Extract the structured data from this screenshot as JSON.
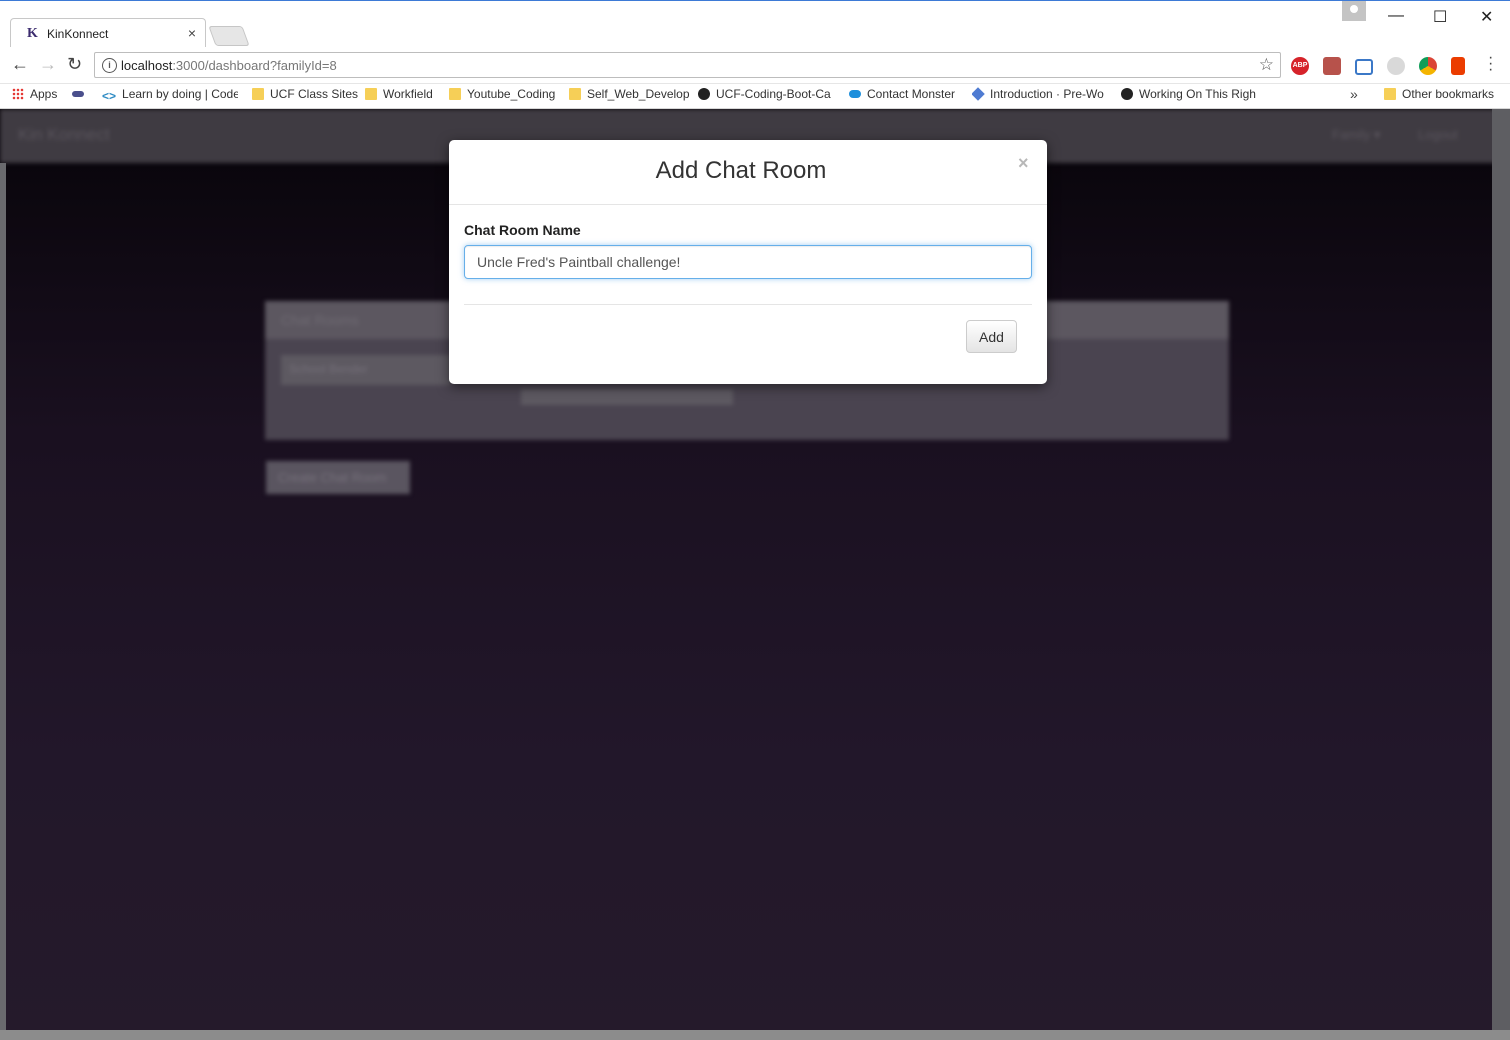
{
  "browser": {
    "tab_title": "KinKonnect",
    "tab_favicon": "K",
    "tab_close": "×",
    "url_host": "localhost",
    "url_rest": ":3000/dashboard?familyId=8",
    "window_controls": {
      "minimize": "—",
      "maximize": "☐",
      "close": "✕"
    }
  },
  "bookmarks": [
    {
      "label": "Apps",
      "icon": "apps-grid-icon"
    },
    {
      "label": "",
      "icon": "extension-oval-icon"
    },
    {
      "label": "Learn by doing | Code",
      "icon": "code-brackets-icon"
    },
    {
      "label": "UCF Class Sites",
      "icon": "folder-icon"
    },
    {
      "label": "Workfield",
      "icon": "folder-icon"
    },
    {
      "label": "Youtube_Coding",
      "icon": "folder-icon"
    },
    {
      "label": "Self_Web_Develop",
      "icon": "folder-icon"
    },
    {
      "label": "UCF-Coding-Boot-Ca",
      "icon": "github-icon"
    },
    {
      "label": "Contact Monster",
      "icon": "cloud-icon"
    },
    {
      "label": "Introduction · Pre-Wo",
      "icon": "book-icon"
    },
    {
      "label": "Working On This Righ",
      "icon": "github-icon"
    },
    {
      "label": "»",
      "icon": "chevron-double-icon"
    },
    {
      "label": "Other bookmarks",
      "icon": "folder-icon"
    }
  ],
  "background_page": {
    "brand": "Kin Konnect",
    "nav_family": "Family ▾",
    "nav_logout": "Logout",
    "panel_title": "Chat Rooms",
    "panel_input_placeholder": "School Bender",
    "create_button": "Create Chat Room"
  },
  "modal": {
    "title": "Add Chat Room",
    "close": "×",
    "field_label": "Chat Room Name",
    "field_value": "Uncle Fred's Paintball challenge!",
    "submit_label": "Add"
  }
}
